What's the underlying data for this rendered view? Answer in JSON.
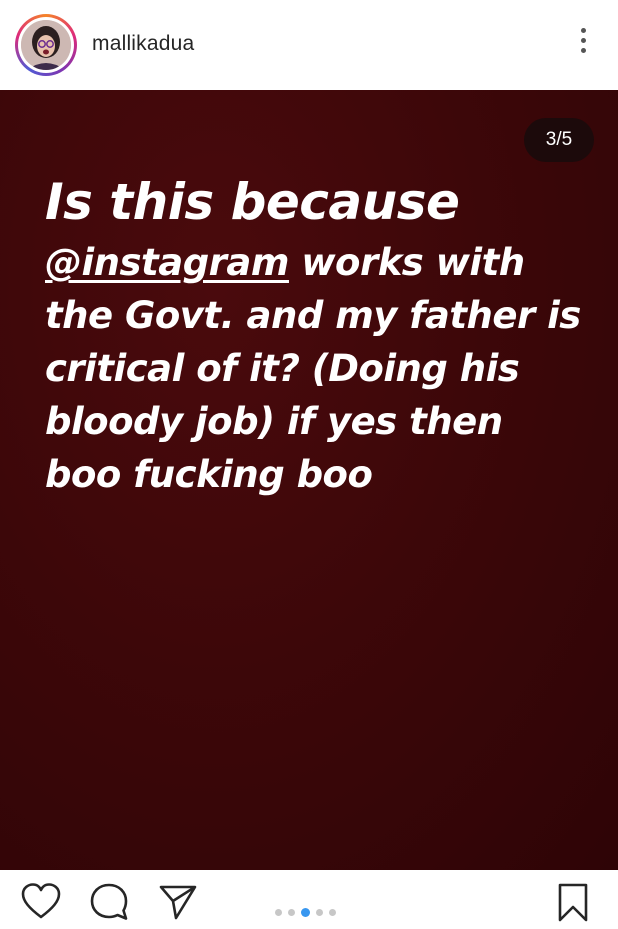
{
  "header": {
    "username": "mallikadua"
  },
  "story": {
    "counter": "3/5",
    "headline": "Is this because",
    "mention": "@instagram",
    "body_after_mention": " works with the Govt. and my father is critical of it? (Doing his bloody job) if yes then boo fucking boo",
    "background_color": "#3d0709"
  },
  "footer": {
    "carousel": {
      "total": 5,
      "active_index": 2
    },
    "icons": [
      "heart-icon",
      "comment-icon",
      "share-icon",
      "bookmark-icon"
    ]
  },
  "colors": {
    "accent": "#3897f0",
    "text_dark": "#262626"
  }
}
